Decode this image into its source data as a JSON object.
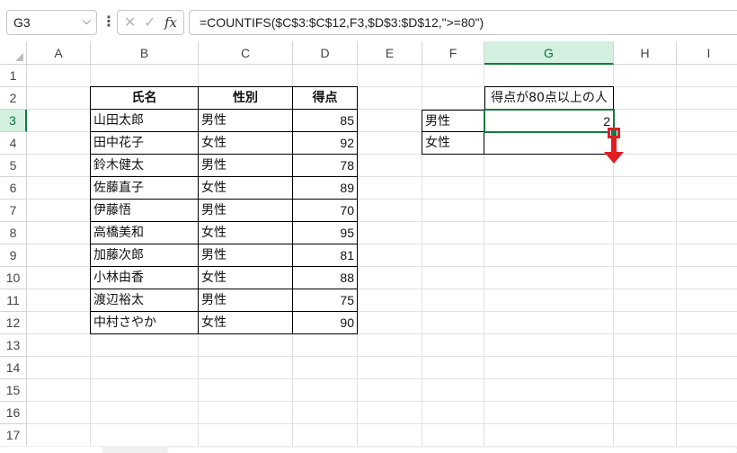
{
  "formula_bar": {
    "name_box": "G3",
    "name_box_chevron": "chevron-down-icon",
    "more_icon": "vertical-ellipsis-icon",
    "cancel_icon": "✕",
    "enter_icon": "✓",
    "fx_label": "fx",
    "formula": "=COUNTIFS($C$3:$C$12,F3,$D$3:$D$12,\">=80\")"
  },
  "columns": [
    "A",
    "B",
    "C",
    "D",
    "E",
    "F",
    "G",
    "H",
    "I"
  ],
  "selected_column": "G",
  "rows": [
    "1",
    "2",
    "3",
    "4",
    "5",
    "6",
    "7",
    "8",
    "9",
    "10",
    "11",
    "12",
    "13",
    "14",
    "15",
    "16",
    "17"
  ],
  "selected_row": "3",
  "table": {
    "headers": [
      "氏名",
      "性別",
      "得点"
    ],
    "records": [
      {
        "name": "山田太郎",
        "gender": "男性",
        "score": "85"
      },
      {
        "name": "田中花子",
        "gender": "女性",
        "score": "92"
      },
      {
        "name": "鈴木健太",
        "gender": "男性",
        "score": "78"
      },
      {
        "name": "佐藤直子",
        "gender": "女性",
        "score": "89"
      },
      {
        "name": "伊藤悟",
        "gender": "男性",
        "score": "70"
      },
      {
        "name": "高橋美和",
        "gender": "女性",
        "score": "95"
      },
      {
        "name": "加藤次郎",
        "gender": "男性",
        "score": "81"
      },
      {
        "name": "小林由香",
        "gender": "女性",
        "score": "88"
      },
      {
        "name": "渡辺裕太",
        "gender": "男性",
        "score": "75"
      },
      {
        "name": "中村さやか",
        "gender": "女性",
        "score": "90"
      }
    ]
  },
  "summary": {
    "header": "得点が80点以上の人",
    "rows": [
      {
        "label": "男性",
        "value": "2"
      },
      {
        "label": "女性",
        "value": ""
      }
    ]
  },
  "colors": {
    "selection": "#107c41",
    "annotation": "#e01e24"
  }
}
